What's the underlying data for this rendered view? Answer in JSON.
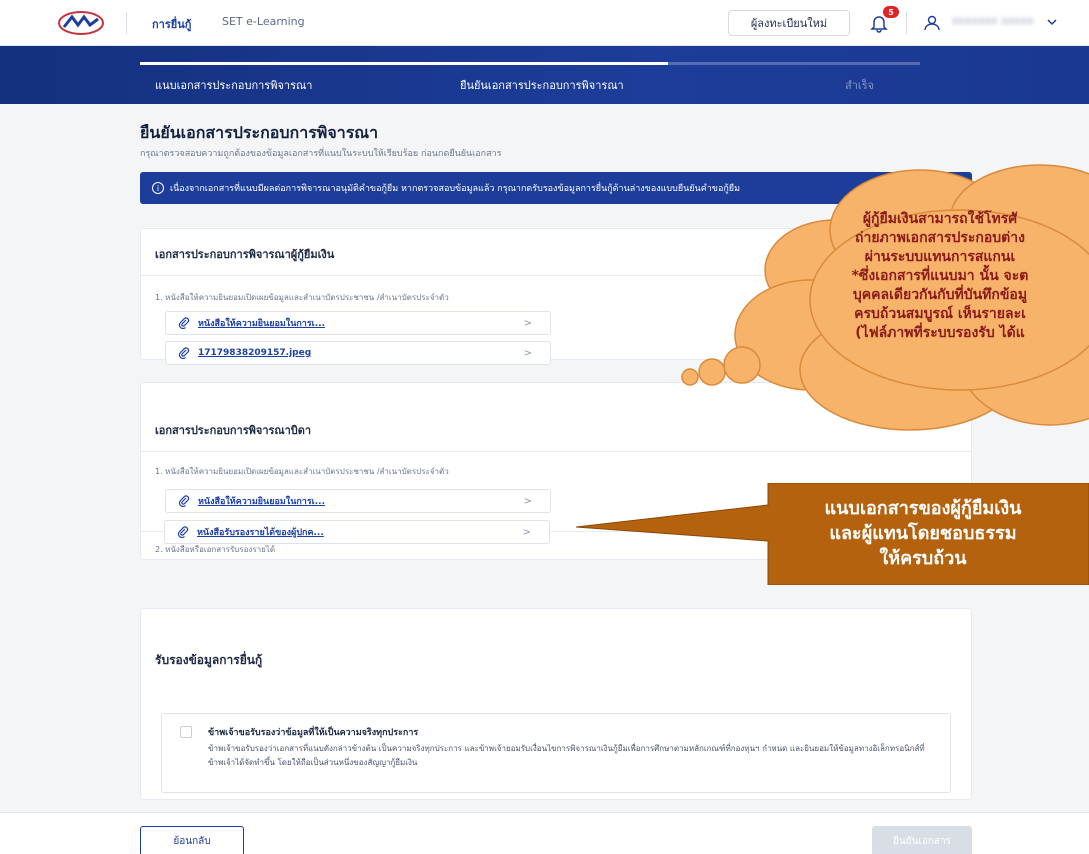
{
  "header": {
    "nav_active": "การยื่นกู้",
    "nav_other": "SET e-Learning",
    "register_button": "ผู้ลงทะเบียนใหม่",
    "notification_count": "5",
    "user_name": "xxxxxxx xxxxx"
  },
  "steps": {
    "step1": "แนบเอกสารประกอบการพิจารณา",
    "step2": "ยืนยันเอกสารประกอบการพิจารณา",
    "step3": "สำเร็จ"
  },
  "page": {
    "title": "ยืนยันเอกสารประกอบการพิจารณา",
    "subtitle": "กรุณาตรวจสอบความถูกต้องของข้อมูลเอกสารที่แนบในระบบให้เรียบร้อย ก่อนกดยืนยันเอกสาร",
    "info_banner": "เนื่องจากเอกสารที่แนบมีผลต่อการพิจารณาอนุมัติคำขอกู้ยืม หากตรวจสอบข้อมูลแล้ว กรุณากดรับรองข้อมูลการยื่นกู้ด้านล่างของแบบยืนยันคำขอกู้ยืม"
  },
  "borrower_section": {
    "title": "เอกสารประกอบการพิจารณาผู้กู้ยืมเงิน",
    "group1_label": "1. หนังสือให้ความยินยอมเปิดเผยข้อมูลและสำเนาบัตรประชาชน /สำเนาบัตรประจำตัว",
    "files": [
      "หนังสือให้ความยินยอมในการเ...",
      "17179838209157.jpeg"
    ]
  },
  "father_section": {
    "title": "เอกสารประกอบการพิจารณาบิดา",
    "group1_label": "1. หนังสือให้ความยินยอมเปิดเผยข้อมูลและสำเนาบัตรประชาชน /สำเนาบัตรประจำตัว",
    "group1_file": "หนังสือให้ความยินยอมในการเ...",
    "group2_label": "2. หนังสือหรือเอกสารรับรองรายได้",
    "group2_file": "หนังสือรับรองรายได้ของผู้ปกค..."
  },
  "certify_section": {
    "title": "รับรองข้อมูลการยื่นกู้",
    "checkbox_title": "ข้าพเจ้าขอรับรองว่าข้อมูลที่ให้เป็นความจริงทุกประการ",
    "checkbox_text": "ข้าพเจ้าขอรับรองว่าเอกสารที่แนบดังกล่าวข้างต้น เป็นความจริงทุกประการ และข้าพเจ้ายอมรับเงื่อนไขการพิจารณาเงินกู้ยืมเพื่อการศึกษาตามหลักเกณฑ์ที่กองทุนฯ กำหนด และยินยอมให้ข้อมูลทางอิเล็กทรอนิกส์ที่ข้าพเจ้าได้จัดทำขึ้น โดยให้ถือเป็นส่วนหนึ่งของสัญญากู้ยืมเงิน"
  },
  "footer": {
    "back_button": "ย้อนกลับ",
    "confirm_button": "ยืนยันเอกสาร"
  },
  "annotations": {
    "cloud_lines": [
      "ผู้กู้ยืมเงินสามารถใช้โทรศั",
      "ถ่ายภาพเอกสารประกอบต่าง",
      "ผ่านระบบแทนการสแกนเ",
      "*ซึ่งเอกสารที่แนบมา นั้น จะต",
      "บุคคลเดียวกันกับที่บันทึกข้อมู",
      "ครบถ้วนสมบูรณ์ เห็นรายละเ",
      "(ไฟล์ภาพที่ระบบรองรับ ได้แ"
    ],
    "callout_lines": [
      "แนบเอกสารของผู้กู้ยืมเงิน",
      "และผู้แทนโดยชอบธรรม",
      "ให้ครบถ้วน"
    ]
  },
  "colors": {
    "primary": "#1d3d9a",
    "cloud_fill": "#f8b36a",
    "callout_fill": "#b5620f"
  }
}
